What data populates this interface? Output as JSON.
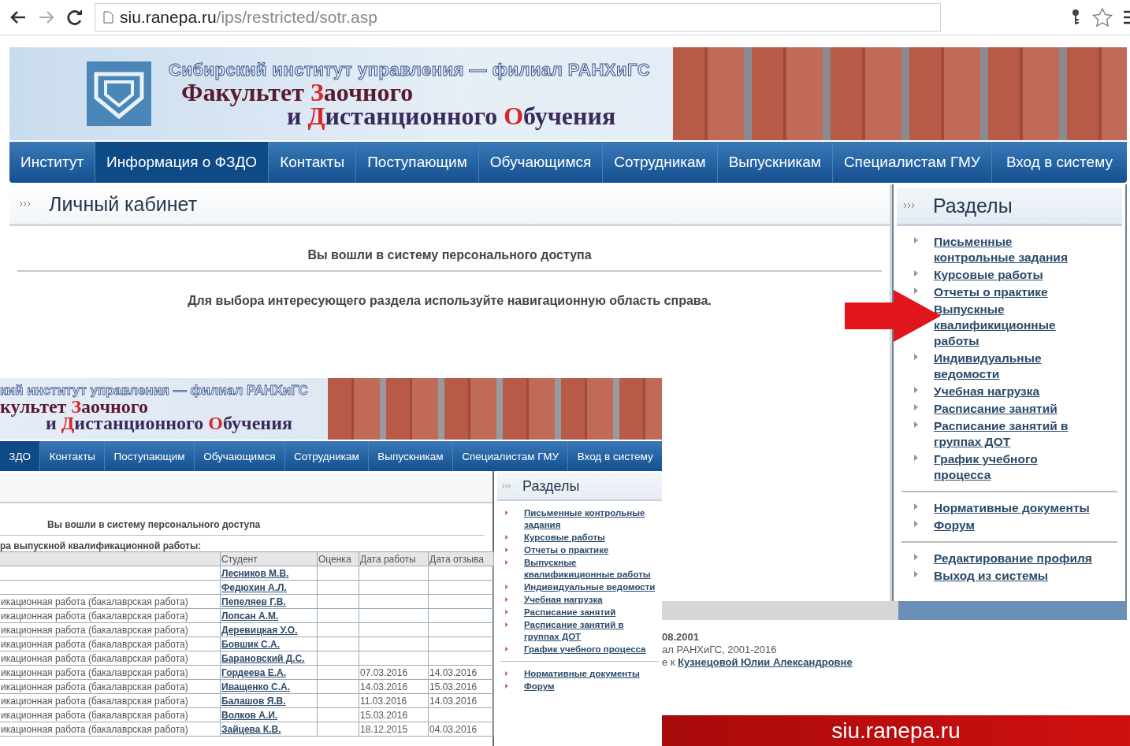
{
  "browser": {
    "address": {
      "host": "siu.ranepa.ru",
      "path": "/ips/restricted/sotr.asp"
    }
  },
  "page": {
    "banner": {
      "subtitle": "Сибирский институт управления — филиал РАНХиГС",
      "title_lines": [
        {
          "parts": [
            {
              "text": "Факультет ",
              "accent": false
            },
            {
              "text": "З",
              "accent": true
            },
            {
              "text": "аочного",
              "accent": false
            }
          ]
        },
        {
          "parts": [
            {
              "text": "и ",
              "accent": false
            },
            {
              "text": "Д",
              "accent": true
            },
            {
              "text": "истанционного ",
              "accent": false
            },
            {
              "text": "О",
              "accent": true
            },
            {
              "text": "бучения",
              "accent": false
            }
          ]
        }
      ]
    },
    "nav": [
      {
        "label": "Институт",
        "selected": false
      },
      {
        "label": "Информация о ФЗДО",
        "selected": true
      },
      {
        "label": "Контакты",
        "selected": false
      },
      {
        "label": "Поступающим",
        "selected": false
      },
      {
        "label": "Обучающимся",
        "selected": false
      },
      {
        "label": "Сотрудникам",
        "selected": false
      },
      {
        "label": "Выпускникам",
        "selected": false
      },
      {
        "label": "Специалистам ГМУ",
        "selected": false
      },
      {
        "label": "Вход в систему",
        "selected": false
      }
    ],
    "content": {
      "title": "Личный кабинет",
      "notice": "Вы вошли в систему персонального доступа",
      "hint": "Для выбора интересующего раздела используйте навигационную область справа."
    },
    "sidebar": {
      "title": "Разделы",
      "groups": [
        [
          "Письменные контрольные задания",
          "Курсовые работы",
          "Отчеты о практике",
          "Выпускные квалификиционные работы",
          "Индивидуальные ведомости",
          "Учебная нагрузка",
          "Расписание занятий",
          "Расписание занятий в группах ДОТ",
          "График учебного процесса"
        ],
        [
          "Нормативные документы",
          "Форум"
        ],
        [
          "Редактирование профиля",
          "Выход из системы"
        ]
      ]
    },
    "footer": {
      "date": "08.2001",
      "copyright": "ал РАНХиГС, 2001-2016",
      "contact_prefix": "е к",
      "contact_link": "Кузнецовой Юлии Александровне"
    }
  },
  "overlay": {
    "banner": {
      "subtitle": "кий институт управления — филиал РАНХиГС",
      "title_lines": [
        {
          "parts": [
            {
              "text": "культет ",
              "accent": false
            },
            {
              "text": "З",
              "accent": true
            },
            {
              "text": "аочного",
              "accent": false
            }
          ]
        },
        {
          "parts": [
            {
              "text": "и ",
              "accent": false
            },
            {
              "text": "Д",
              "accent": true
            },
            {
              "text": "истанционного ",
              "accent": false
            },
            {
              "text": "О",
              "accent": true
            },
            {
              "text": "бучения",
              "accent": false
            }
          ]
        }
      ]
    },
    "nav": [
      {
        "label": "ЗДО",
        "selected": true
      },
      {
        "label": "Контакты",
        "selected": false
      },
      {
        "label": "Поступающим",
        "selected": false
      },
      {
        "label": "Обучающимся",
        "selected": false
      },
      {
        "label": "Сотрудникам",
        "selected": false
      },
      {
        "label": "Выпускникам",
        "selected": false
      },
      {
        "label": "Специалистам ГМУ",
        "selected": false
      },
      {
        "label": "Вход в систему",
        "selected": false
      }
    ],
    "content": {
      "notice": "Вы вошли в систему персонального доступа",
      "caption": "ра выпускной квалификационной работы:",
      "table": {
        "columns": [
          "Студент",
          "Оценка",
          "Дата работы",
          "Дата отзыва"
        ],
        "rows": [
          {
            "student": "Лесников М.В."
          },
          {
            "student": "Федюхин А.Л."
          },
          {
            "column_1": "икационная работа (бакалаврская работа)",
            "student": "Пепеляев Г.В."
          },
          {
            "column_1": "икационная работа (бакалаврская работа)",
            "student": "Лопсан А.М."
          },
          {
            "column_1": "икационная работа (бакалаврская работа)",
            "student": "Деревицкая У.О."
          },
          {
            "column_1": "икационная работа (бакалаврская работа)",
            "student": "Бовшик С.А."
          },
          {
            "column_1": "икационная работа (бакалаврская работа)",
            "student": "Барановский Д.С."
          },
          {
            "column_1": "икационная работа (бакалаврская работа)",
            "student": "Гордеева Е.А.",
            "work_date": "07.03.2016",
            "review_date": "14.03.2016"
          },
          {
            "column_1": "икационная работа (бакалаврская работа)",
            "student": "Иващенко С.А.",
            "work_date": "14.03.2016",
            "review_date": "15.03.2016"
          },
          {
            "column_1": "икационная работа (бакалаврская работа)",
            "student": "Балашов Я.В.",
            "work_date": "11.03.2016",
            "review_date": "14.03.2016"
          },
          {
            "column_1": "икационная работа (бакалаврская работа)",
            "student": "Волков А.И.",
            "work_date": "15.03.2016"
          },
          {
            "column_1": "икационная работа (бакалаврская работа)",
            "student": "Зайцева К.В.",
            "work_date": "18.12.2015",
            "review_date": "04.03.2016"
          }
        ]
      }
    },
    "sidebar": {
      "title": "Разделы",
      "groups": [
        [
          "Письменные контрольные задания",
          "Курсовые работы",
          "Отчеты о практике",
          "Выпускные квалификиционные работы",
          "Индивидуальные ведомости",
          "Учебная нагрузка",
          "Расписание занятий",
          "Расписание занятий в группах ДОТ",
          "График учебного процесса"
        ],
        [
          "Нормативные документы",
          "Форум"
        ]
      ]
    }
  },
  "caption_bar": {
    "text": "siu.ranepa.ru"
  }
}
